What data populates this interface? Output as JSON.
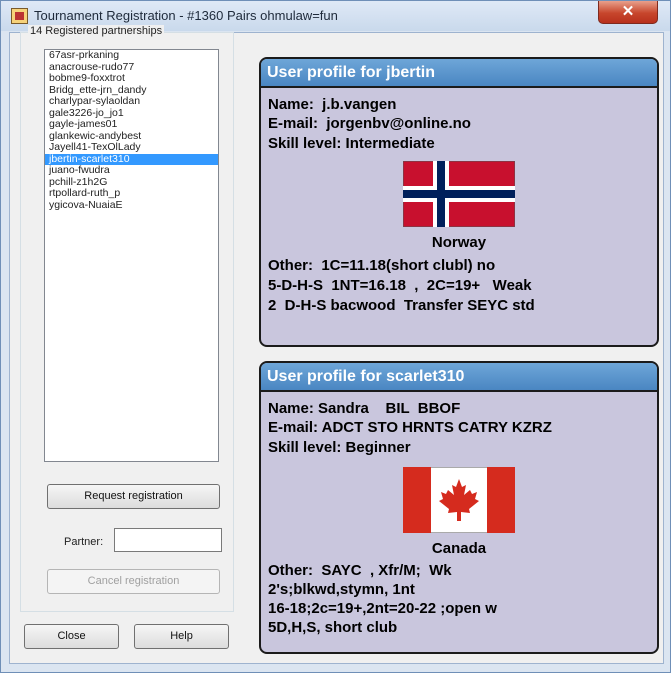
{
  "window": {
    "title": "Tournament Registration - #1360 Pairs ohmulaw=fun",
    "close_glyph": "✕"
  },
  "registered": {
    "legend": "14 Registered partnerships",
    "items": [
      "67asr-prkaning",
      "anacrouse-rudo77",
      "bobme9-foxxtrot",
      "Bridg_ette-jrn_dandy",
      "charlypar-sylaoldan",
      "gale3226-jo_jo1",
      "gayle-james01",
      "glankewic-andybest",
      "Jayell41-TexOlLady",
      "jbertin-scarlet310",
      "juano-fwudra",
      "pchill-z1h2G",
      "rtpollard-ruth_p",
      "ygicova-NuaiaE"
    ],
    "selected_index": 9
  },
  "controls": {
    "request_label": "Request registration",
    "partner_label": "Partner:",
    "partner_value": "",
    "cancel_label": "Cancel registration",
    "close_label": "Close",
    "help_label": "Help"
  },
  "profile1": {
    "header": "User profile for jbertin",
    "name": "Name:  j.b.vangen",
    "email": "E-mail:  jorgenbv@online.no",
    "skill": "Skill level: Intermediate",
    "country": "Norway",
    "other": [
      "Other:  1C=11.18(short clubl) no",
      "5-D-H-S  1NT=16.18  ,  2C=19+   Weak",
      "2  D-H-S bacwood  Transfer SEYC std"
    ],
    "flag_colors": {
      "field": "#c8102e",
      "cross_outer": "#ffffff",
      "cross_inner": "#00205b"
    }
  },
  "profile2": {
    "header": "User profile for scarlet310",
    "name": "Name: Sandra    BIL  BBOF",
    "email": "E-mail: ADCT STO HRNTS CATRY KZRZ",
    "skill": "Skill level: Beginner",
    "country": "Canada",
    "other": [
      "Other:  SAYC  , Xfr/M;  Wk",
      "2's;blkwd,stymn, 1nt",
      "16-18;2c=19+,2nt=20-22 ;open w",
      "5D,H,S, short club"
    ],
    "flag_colors": {
      "bar": "#d52b1e",
      "field": "#ffffff"
    }
  }
}
